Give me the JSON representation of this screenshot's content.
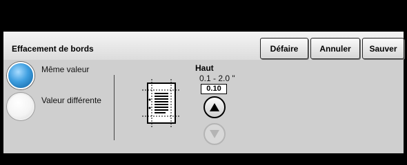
{
  "header": {
    "title": "Effacement de bords",
    "buttons": {
      "undo": "Défaire",
      "cancel": "Annuler",
      "save": "Sauver"
    }
  },
  "options": {
    "same_value": "Même valeur",
    "different_value": "Valeur différente",
    "selected": "same_value"
  },
  "edge": {
    "label": "Haut",
    "range": "0.1 -  2.0 \"",
    "value": "0.10",
    "up_icon": "arrow-up-icon",
    "down_icon": "arrow-down-icon",
    "down_enabled": false
  },
  "colors": {
    "selected_radio": "#3f9fe0",
    "panel_bg": "#cfcfcf",
    "header_bg": "#e8e8e8"
  }
}
